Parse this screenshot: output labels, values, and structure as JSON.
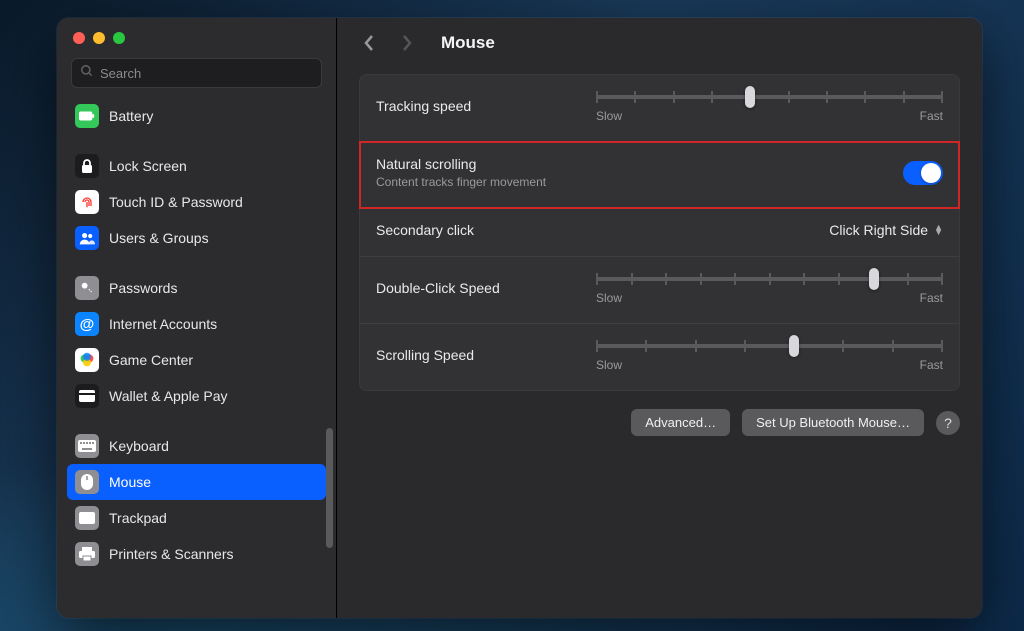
{
  "search": {
    "placeholder": "Search"
  },
  "sidebar": {
    "groups": [
      {
        "items": [
          {
            "label": "Battery",
            "icon_bg": "#34c759",
            "icon_fg": "#fff",
            "name": "battery"
          }
        ]
      },
      {
        "items": [
          {
            "label": "Lock Screen",
            "icon_bg": "#1c1c1e",
            "icon_fg": "#fff",
            "name": "lock-screen"
          },
          {
            "label": "Touch ID & Password",
            "icon_bg": "#ffffff",
            "icon_fg": "#ff3b30",
            "name": "touch-id"
          },
          {
            "label": "Users & Groups",
            "icon_bg": "#0a60ff",
            "icon_fg": "#fff",
            "name": "users-groups"
          }
        ]
      },
      {
        "items": [
          {
            "label": "Passwords",
            "icon_bg": "#8e8e93",
            "icon_fg": "#fff",
            "name": "passwords"
          },
          {
            "label": "Internet Accounts",
            "icon_bg": "#0a84ff",
            "icon_fg": "#fff",
            "name": "internet-accounts"
          },
          {
            "label": "Game Center",
            "icon_bg": "#ffffff",
            "icon_fg": "#ff2d55",
            "name": "game-center"
          },
          {
            "label": "Wallet & Apple Pay",
            "icon_bg": "#1c1c1e",
            "icon_fg": "#fff",
            "name": "wallet"
          }
        ]
      },
      {
        "items": [
          {
            "label": "Keyboard",
            "icon_bg": "#8e8e93",
            "icon_fg": "#fff",
            "name": "keyboard"
          },
          {
            "label": "Mouse",
            "icon_bg": "#8e8e93",
            "icon_fg": "#fff",
            "name": "mouse",
            "selected": true
          },
          {
            "label": "Trackpad",
            "icon_bg": "#8e8e93",
            "icon_fg": "#fff",
            "name": "trackpad"
          },
          {
            "label": "Printers & Scanners",
            "icon_bg": "#8e8e93",
            "icon_fg": "#fff",
            "name": "printers"
          }
        ]
      }
    ]
  },
  "header": {
    "title": "Mouse"
  },
  "settings": {
    "tracking": {
      "label": "Tracking speed",
      "min_label": "Slow",
      "max_label": "Fast",
      "ticks": 10,
      "value": 4
    },
    "natural_scroll": {
      "label": "Natural scrolling",
      "sub": "Content tracks finger movement",
      "on": true,
      "highlight": true
    },
    "secondary": {
      "label": "Secondary click",
      "value": "Click Right Side"
    },
    "double_click": {
      "label": "Double-Click Speed",
      "min_label": "Slow",
      "max_label": "Fast",
      "ticks": 11,
      "value": 8
    },
    "scrolling": {
      "label": "Scrolling Speed",
      "min_label": "Slow",
      "max_label": "Fast",
      "ticks": 8,
      "value": 4
    }
  },
  "footer": {
    "advanced": "Advanced…",
    "bluetooth": "Set Up Bluetooth Mouse…",
    "help": "?"
  }
}
